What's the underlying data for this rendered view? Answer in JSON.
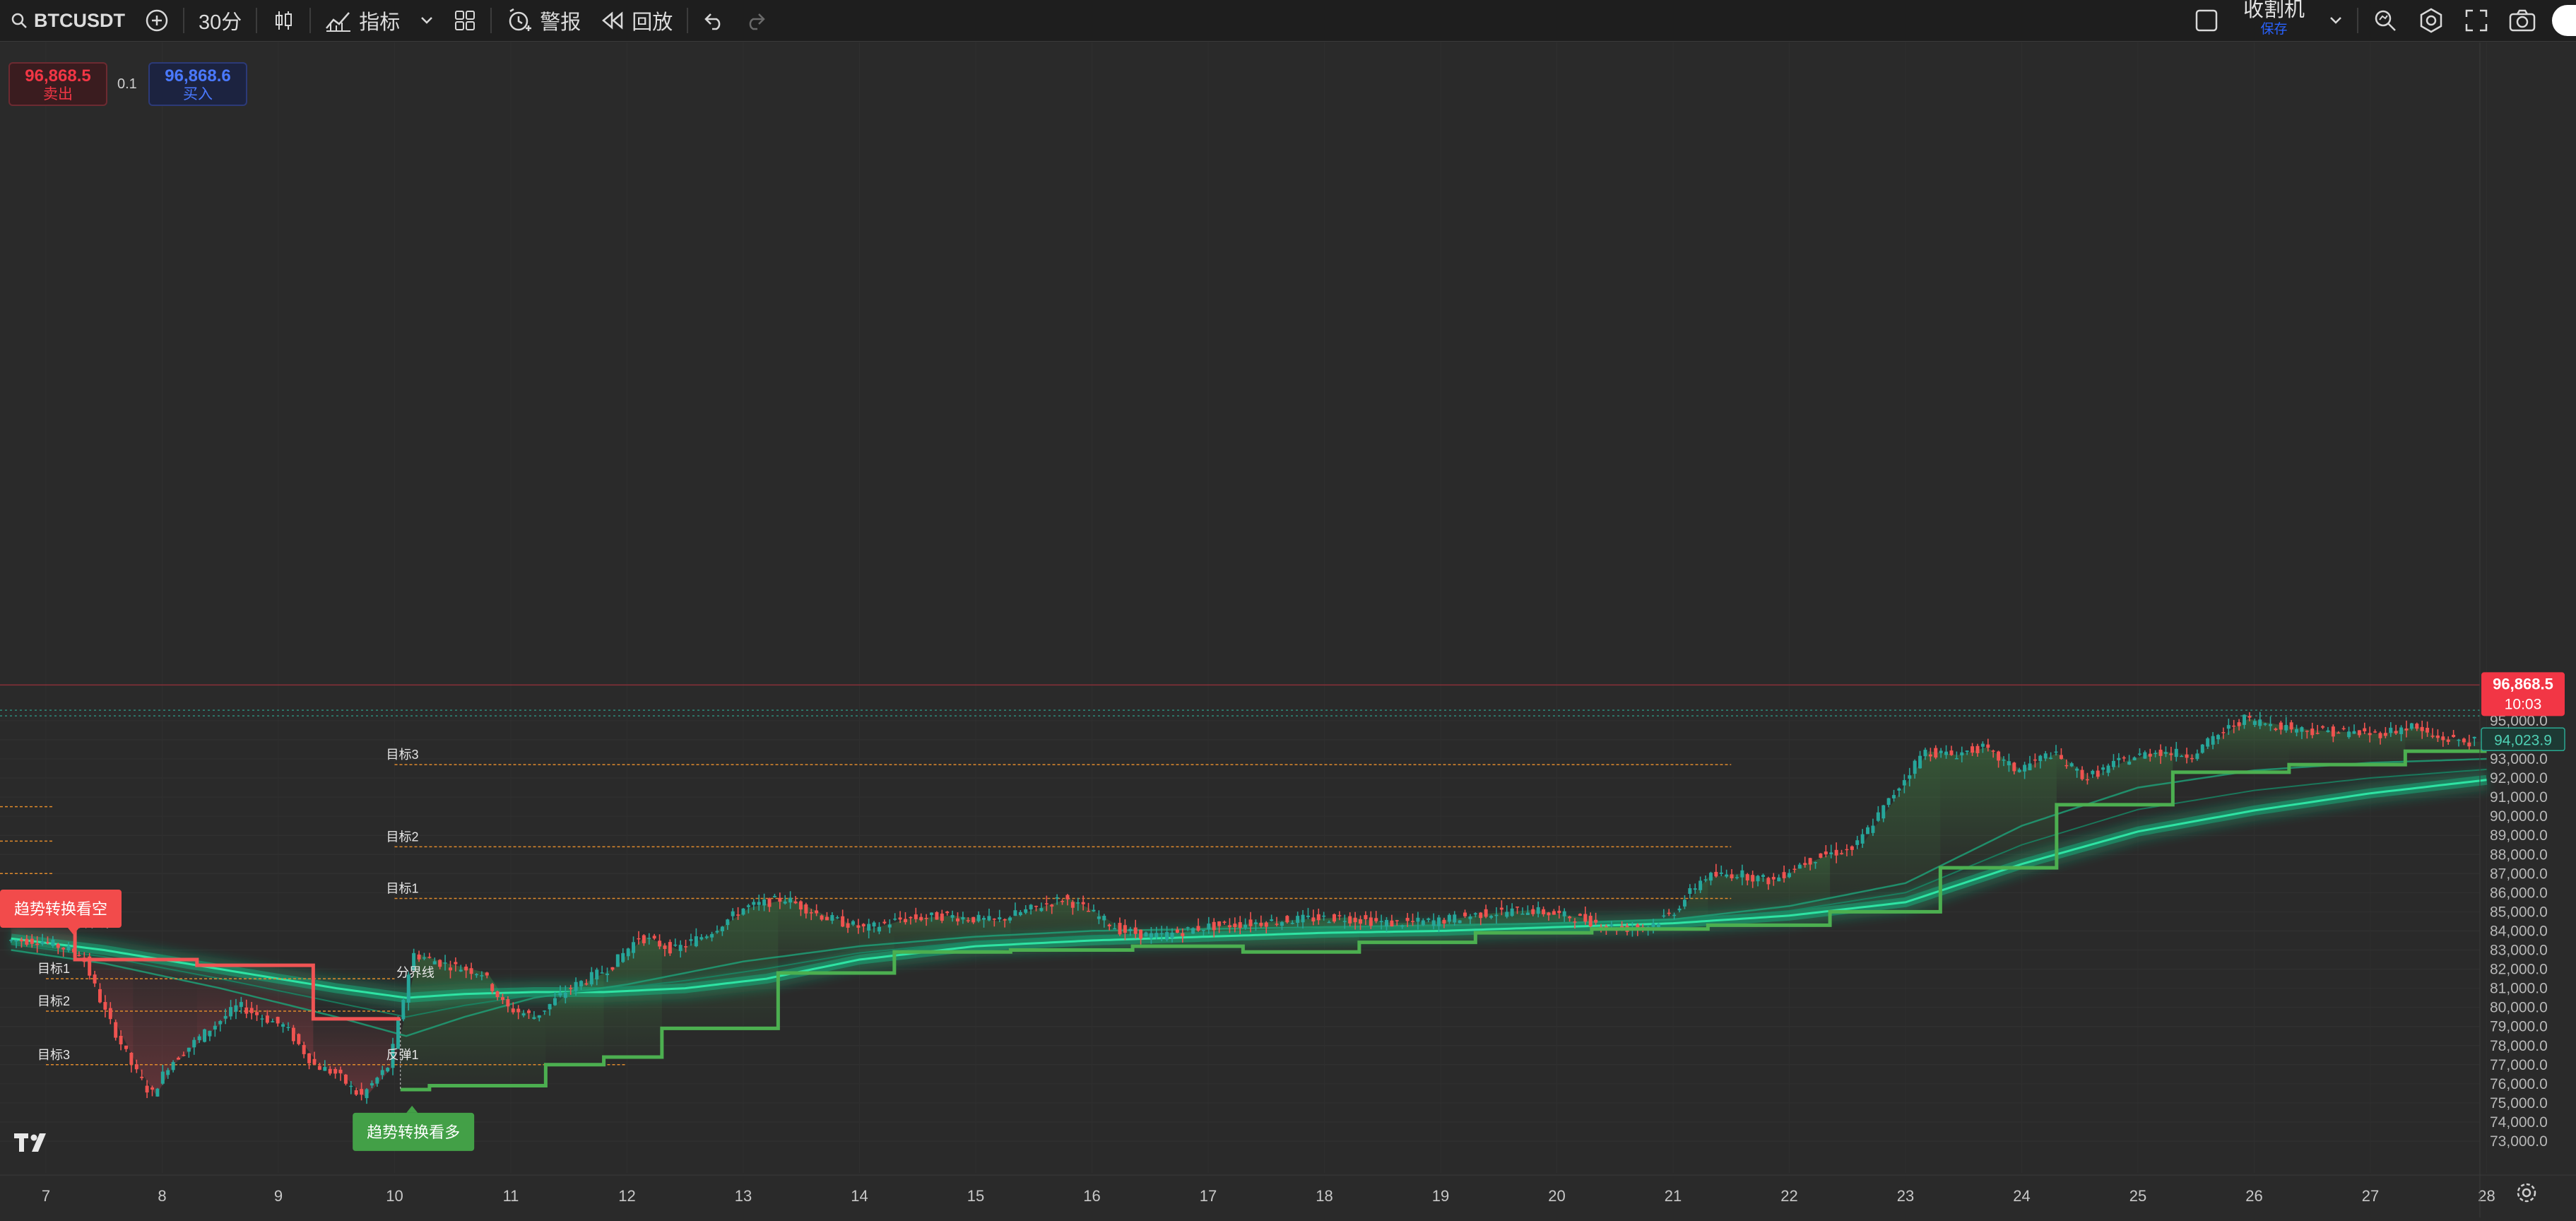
{
  "toolbar": {
    "symbol": "BTCUSDT",
    "interval": "30分",
    "indicators_label": "指标",
    "alert_label": "警报",
    "replay_label": "回放",
    "layout_name": "收割机",
    "layout_status": "保存"
  },
  "trade": {
    "sell_price": "96,868.5",
    "sell_label": "卖出",
    "spread": "0.1",
    "buy_price": "96,868.6",
    "buy_label": "买入"
  },
  "price_tags": {
    "last_price": "96,868.5",
    "countdown": "10:03",
    "ma_value": "94,023.9"
  },
  "chart_data": {
    "type": "candlestick",
    "symbol": "BTCUSDT",
    "interval": "30分",
    "y_axis": {
      "ticks": [
        73000,
        74000,
        75000,
        76000,
        77000,
        78000,
        79000,
        80000,
        81000,
        82000,
        83000,
        84000,
        85000,
        86000,
        87000,
        88000,
        89000,
        90000,
        91000,
        92000,
        93000,
        94000,
        95000
      ],
      "tick_labels": [
        "73,000.0",
        "74,000.0",
        "75,000.0",
        "76,000.0",
        "77,000.0",
        "78,000.0",
        "79,000.0",
        "80,000.0",
        "81,000.0",
        "82,000.0",
        "83,000.0",
        "84,000.0",
        "85,000.0",
        "86,000.0",
        "87,000.0",
        "88,000.0",
        "89,000.0",
        "90,000.0",
        "91,000.0",
        "92,000.0",
        "93,000.0",
        "94,000.0",
        "95,000.0"
      ]
    },
    "x_axis": {
      "tick_labels": [
        "7",
        "8",
        "9",
        "10",
        "11",
        "12",
        "13",
        "14",
        "15",
        "16",
        "17",
        "18",
        "19",
        "20",
        "21",
        "22",
        "23",
        "24",
        "25",
        "26",
        "27",
        "28"
      ]
    },
    "price_path": [
      {
        "d": 7.0,
        "p": 83500
      },
      {
        "d": 7.35,
        "p": 82800
      },
      {
        "d": 7.55,
        "p": 79800
      },
      {
        "d": 7.8,
        "p": 76800
      },
      {
        "d": 7.95,
        "p": 75400
      },
      {
        "d": 8.1,
        "p": 77000
      },
      {
        "d": 8.4,
        "p": 78600
      },
      {
        "d": 8.7,
        "p": 80100
      },
      {
        "d": 8.9,
        "p": 79500
      },
      {
        "d": 9.1,
        "p": 79000
      },
      {
        "d": 9.35,
        "p": 77000
      },
      {
        "d": 9.55,
        "p": 76500
      },
      {
        "d": 9.75,
        "p": 75300
      },
      {
        "d": 10.0,
        "p": 77000
      },
      {
        "d": 10.2,
        "p": 82800
      },
      {
        "d": 10.45,
        "p": 82300
      },
      {
        "d": 10.8,
        "p": 81800
      },
      {
        "d": 11.0,
        "p": 80000
      },
      {
        "d": 11.25,
        "p": 79500
      },
      {
        "d": 11.55,
        "p": 81000
      },
      {
        "d": 11.9,
        "p": 82100
      },
      {
        "d": 12.15,
        "p": 83700
      },
      {
        "d": 12.45,
        "p": 83000
      },
      {
        "d": 12.75,
        "p": 83900
      },
      {
        "d": 13.05,
        "p": 85200
      },
      {
        "d": 13.4,
        "p": 85700
      },
      {
        "d": 13.75,
        "p": 84700
      },
      {
        "d": 14.1,
        "p": 84100
      },
      {
        "d": 14.4,
        "p": 84600
      },
      {
        "d": 14.8,
        "p": 84800
      },
      {
        "d": 15.2,
        "p": 84500
      },
      {
        "d": 15.5,
        "p": 85100
      },
      {
        "d": 15.8,
        "p": 85700
      },
      {
        "d": 16.0,
        "p": 85100
      },
      {
        "d": 16.3,
        "p": 84000
      },
      {
        "d": 16.6,
        "p": 83700
      },
      {
        "d": 17.0,
        "p": 84200
      },
      {
        "d": 17.4,
        "p": 84400
      },
      {
        "d": 17.8,
        "p": 84600
      },
      {
        "d": 18.2,
        "p": 84700
      },
      {
        "d": 18.6,
        "p": 84400
      },
      {
        "d": 19.0,
        "p": 84500
      },
      {
        "d": 19.4,
        "p": 84900
      },
      {
        "d": 19.8,
        "p": 85100
      },
      {
        "d": 20.2,
        "p": 84700
      },
      {
        "d": 20.6,
        "p": 84100
      },
      {
        "d": 20.85,
        "p": 84300
      },
      {
        "d": 21.05,
        "p": 85000
      },
      {
        "d": 21.3,
        "p": 86800
      },
      {
        "d": 21.6,
        "p": 87000
      },
      {
        "d": 21.9,
        "p": 86600
      },
      {
        "d": 22.1,
        "p": 87400
      },
      {
        "d": 22.35,
        "p": 88000
      },
      {
        "d": 22.6,
        "p": 88300
      },
      {
        "d": 22.9,
        "p": 90800
      },
      {
        "d": 23.2,
        "p": 93400
      },
      {
        "d": 23.45,
        "p": 93200
      },
      {
        "d": 23.7,
        "p": 93600
      },
      {
        "d": 24.0,
        "p": 92400
      },
      {
        "d": 24.3,
        "p": 93300
      },
      {
        "d": 24.6,
        "p": 92000
      },
      {
        "d": 24.9,
        "p": 92900
      },
      {
        "d": 25.2,
        "p": 93400
      },
      {
        "d": 25.5,
        "p": 93200
      },
      {
        "d": 25.75,
        "p": 94300
      },
      {
        "d": 25.95,
        "p": 95100
      },
      {
        "d": 26.2,
        "p": 94800
      },
      {
        "d": 26.5,
        "p": 94500
      },
      {
        "d": 26.8,
        "p": 94400
      },
      {
        "d": 27.1,
        "p": 94300
      },
      {
        "d": 27.4,
        "p": 94700
      },
      {
        "d": 27.6,
        "p": 94100
      },
      {
        "d": 27.9,
        "p": 93900
      }
    ],
    "red_stair": [
      {
        "from": 6.7,
        "to": 7.25,
        "p": 84500
      },
      {
        "from": 7.25,
        "to": 7.75,
        "p": 82500
      },
      {
        "from": 7.75,
        "to": 8.3,
        "p": 82500
      },
      {
        "from": 8.3,
        "to": 9.3,
        "p": 82200
      },
      {
        "from": 9.3,
        "to": 10.05,
        "p": 79400
      }
    ],
    "green_stair": [
      {
        "from": 10.05,
        "to": 10.3,
        "p": 75700
      },
      {
        "from": 10.3,
        "to": 11.3,
        "p": 75900
      },
      {
        "from": 11.3,
        "to": 11.8,
        "p": 77000
      },
      {
        "from": 11.8,
        "to": 12.3,
        "p": 77400
      },
      {
        "from": 12.3,
        "to": 13.3,
        "p": 78900
      },
      {
        "from": 13.3,
        "to": 14.3,
        "p": 81800
      },
      {
        "from": 14.3,
        "to": 15.3,
        "p": 82900
      },
      {
        "from": 15.3,
        "to": 16.35,
        "p": 83000
      },
      {
        "from": 16.35,
        "to": 17.3,
        "p": 83200
      },
      {
        "from": 17.3,
        "to": 18.3,
        "p": 82900
      },
      {
        "from": 18.3,
        "to": 19.3,
        "p": 83400
      },
      {
        "from": 19.3,
        "to": 20.3,
        "p": 83900
      },
      {
        "from": 20.3,
        "to": 21.3,
        "p": 84100
      },
      {
        "from": 21.3,
        "to": 22.35,
        "p": 84300
      },
      {
        "from": 22.35,
        "to": 23.3,
        "p": 85000
      },
      {
        "from": 23.3,
        "to": 24.3,
        "p": 87300
      },
      {
        "from": 24.3,
        "to": 25.3,
        "p": 90600
      },
      {
        "from": 25.3,
        "to": 26.3,
        "p": 92300
      },
      {
        "from": 26.3,
        "to": 27.3,
        "p": 92700
      },
      {
        "from": 27.3,
        "to": 28.0,
        "p": 93400
      }
    ],
    "ema_slow": [
      {
        "d": 6.7,
        "p": 83600
      },
      {
        "d": 7.5,
        "p": 83000
      },
      {
        "d": 8.5,
        "p": 82000
      },
      {
        "d": 9.5,
        "p": 81000
      },
      {
        "d": 10.1,
        "p": 80500
      },
      {
        "d": 10.6,
        "p": 80700
      },
      {
        "d": 11.2,
        "p": 80800
      },
      {
        "d": 11.8,
        "p": 80800
      },
      {
        "d": 12.5,
        "p": 81000
      },
      {
        "d": 13.2,
        "p": 81500
      },
      {
        "d": 14.0,
        "p": 82500
      },
      {
        "d": 15.0,
        "p": 83200
      },
      {
        "d": 16.0,
        "p": 83500
      },
      {
        "d": 17.0,
        "p": 83700
      },
      {
        "d": 18.0,
        "p": 83900
      },
      {
        "d": 19.0,
        "p": 84000
      },
      {
        "d": 20.0,
        "p": 84200
      },
      {
        "d": 21.0,
        "p": 84400
      },
      {
        "d": 22.0,
        "p": 84800
      },
      {
        "d": 23.0,
        "p": 85500
      },
      {
        "d": 24.0,
        "p": 87500
      },
      {
        "d": 25.0,
        "p": 89200
      },
      {
        "d": 26.0,
        "p": 90300
      },
      {
        "d": 27.0,
        "p": 91200
      },
      {
        "d": 28.0,
        "p": 91900
      }
    ],
    "ema_fast": [
      {
        "d": 6.7,
        "p": 83000
      },
      {
        "d": 7.5,
        "p": 82300
      },
      {
        "d": 8.5,
        "p": 81000
      },
      {
        "d": 9.5,
        "p": 79500
      },
      {
        "d": 10.1,
        "p": 78500
      },
      {
        "d": 10.6,
        "p": 79500
      },
      {
        "d": 11.2,
        "p": 80500
      },
      {
        "d": 12.0,
        "p": 81200
      },
      {
        "d": 13.0,
        "p": 82400
      },
      {
        "d": 14.0,
        "p": 83200
      },
      {
        "d": 15.0,
        "p": 83700
      },
      {
        "d": 16.0,
        "p": 84000
      },
      {
        "d": 17.0,
        "p": 84100
      },
      {
        "d": 18.0,
        "p": 84200
      },
      {
        "d": 19.0,
        "p": 84300
      },
      {
        "d": 20.0,
        "p": 84400
      },
      {
        "d": 21.0,
        "p": 84600
      },
      {
        "d": 22.0,
        "p": 85300
      },
      {
        "d": 23.0,
        "p": 86500
      },
      {
        "d": 24.0,
        "p": 89500
      },
      {
        "d": 25.0,
        "p": 91500
      },
      {
        "d": 26.0,
        "p": 92400
      },
      {
        "d": 27.0,
        "p": 92800
      },
      {
        "d": 28.0,
        "p": 93000
      }
    ],
    "hlines": [
      {
        "label": "目标3",
        "from": 10.0,
        "to": 21.5,
        "p": 92700
      },
      {
        "label": "目标2",
        "from": 10.0,
        "to": 21.5,
        "p": 88400
      },
      {
        "label": "目标1",
        "from": 10.0,
        "to": 21.5,
        "p": 85700
      },
      {
        "label": "目标1",
        "from": 7.0,
        "to": 10.0,
        "p": 81500
      },
      {
        "label": "目标2",
        "from": 7.0,
        "to": 10.0,
        "p": 79800
      },
      {
        "label": "目标3",
        "from": 7.0,
        "to": 10.0,
        "p": 77000
      },
      {
        "label": "反弹1",
        "from": 10.0,
        "to": 12.0,
        "p": 77000
      }
    ],
    "dividers": [
      {
        "label": "分界线",
        "d": 7.3,
        "p": 84200
      },
      {
        "label": "分界线",
        "d": 10.1,
        "p": 81600
      }
    ],
    "trend_labels": [
      {
        "text": "趋势转换看空",
        "d": 7.0,
        "p": 85200,
        "color": "#f24b4b"
      },
      {
        "text": "趋势转换看多",
        "d": 10.15,
        "p": 75000,
        "color": "#43a047"
      }
    ],
    "top_dotted_line": 95250,
    "colors": {
      "up": "#26a69a",
      "down": "#ef5350",
      "bg": "#2a2a2a",
      "stair_up": "#4caf50",
      "stair_down": "#f05454",
      "ema": "#1fd190",
      "target": "#e08a2c",
      "last_price": "#f23645"
    }
  }
}
